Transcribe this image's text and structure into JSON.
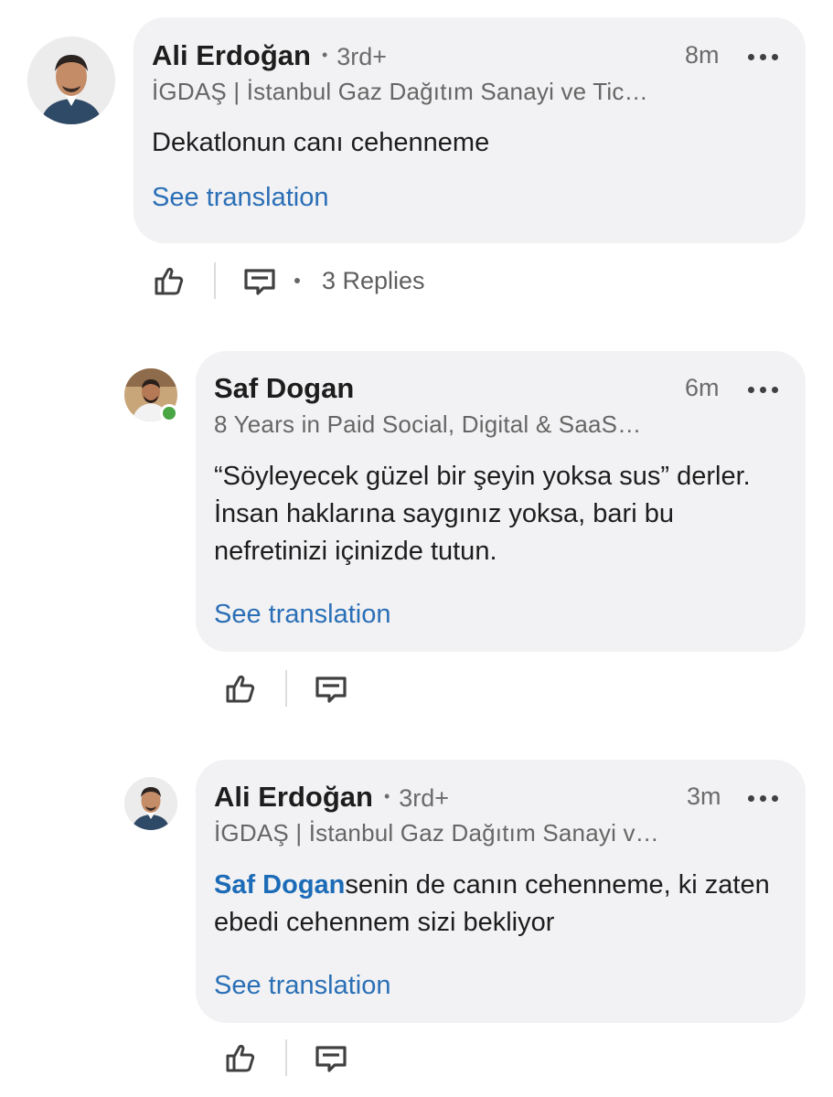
{
  "comments": [
    {
      "author": "Ali Erdoğan",
      "degree": "3rd+",
      "time": "8m",
      "headline": "İGDAŞ | İstanbul Gaz Dağıtım Sanayi ve Tic…",
      "text": "Dekatlonun canı cehenneme",
      "translate_label": "See translation",
      "replies_label": "3 Replies"
    },
    {
      "author": "Saf Dogan",
      "time": "6m",
      "headline": "8 Years in Paid Social, Digital & SaaS…",
      "text": "“Söyleyecek güzel bir şeyin yoksa sus” derler. İnsan haklarına saygınız yoksa, bari bu nefretinizi içinizde tutun.",
      "translate_label": "See translation"
    },
    {
      "author": "Ali Erdoğan",
      "degree": "3rd+",
      "time": "3m",
      "headline": "İGDAŞ | İstanbul Gaz Dağıtım Sanayi v…",
      "mention": "Saf Dogan",
      "text": "senin de canın cehenneme, ki zaten ebedi cehennem sizi bekliyor",
      "translate_label": "See translation"
    }
  ],
  "icons": {
    "like": "thumbs-up-icon",
    "reply": "comment-icon",
    "more": "more-icon"
  },
  "colors": {
    "bubble": "#f2f2f4",
    "link": "#2a6fb6",
    "presence": "#4aa544"
  }
}
